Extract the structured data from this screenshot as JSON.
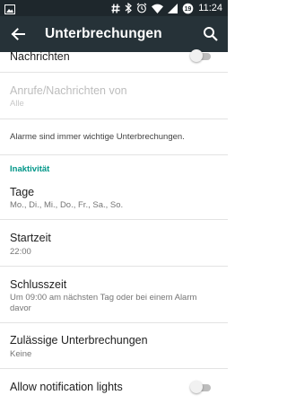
{
  "status_bar": {
    "time": "11:24",
    "battery_level": "19",
    "icons": [
      "image-icon",
      "hash-icon",
      "bluetooth-icon",
      "alarm-icon",
      "wifi-icon",
      "signal-icon",
      "battery-icon"
    ]
  },
  "app_bar": {
    "title": "Unterbrechungen",
    "back_icon": "arrow-back-icon",
    "search_icon": "search-icon"
  },
  "settings": {
    "nachrichten": {
      "title": "Nachrichten",
      "enabled": false
    },
    "anrufe": {
      "title": "Anrufe/Nachrichten von",
      "value": "Alle",
      "disabled": true
    },
    "alarm_note": "Alarme sind immer wichtige Unterbrechungen.",
    "section_inaktivitaet": "Inaktivität",
    "tage": {
      "title": "Tage",
      "value": "Mo., Di., Mi., Do., Fr., Sa., So."
    },
    "startzeit": {
      "title": "Startzeit",
      "value": "22:00"
    },
    "schlusszeit": {
      "title": "Schlusszeit",
      "value": "Um 09:00 am nächsten Tag oder bei einem Alarm davor"
    },
    "zulaessige": {
      "title": "Zulässige Unterbrechungen",
      "value": "Keine"
    },
    "notification_lights": {
      "title": "Allow notification lights",
      "enabled": false
    }
  },
  "colors": {
    "status_bar": "#1e272c",
    "app_bar": "#263238",
    "accent": "#009688"
  }
}
